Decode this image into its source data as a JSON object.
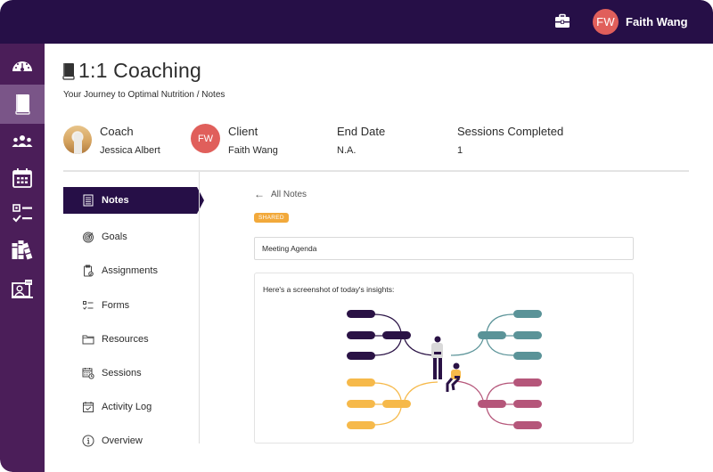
{
  "topbar": {
    "briefcase_icon": "briefcase-icon",
    "user_initials": "FW",
    "user_name": "Faith Wang",
    "avatar_color": "#e05f5b"
  },
  "rail": {
    "items": [
      {
        "icon": "dashboard-gauge-icon",
        "active": false
      },
      {
        "icon": "book-icon",
        "active": true
      },
      {
        "icon": "group-icon",
        "active": false
      },
      {
        "icon": "calendar-icon",
        "active": false
      },
      {
        "icon": "checklist-icon",
        "active": false
      },
      {
        "icon": "library-icon",
        "active": false
      },
      {
        "icon": "presentation-icon",
        "active": false
      }
    ]
  },
  "header": {
    "title": "1:1 Coaching",
    "breadcrumb": "Your Journey to Optimal Nutrition / Notes"
  },
  "info": {
    "coach_label": "Coach",
    "coach_name": "Jessica Albert",
    "client_label": "Client",
    "client_initials": "FW",
    "client_name": "Faith Wang",
    "end_date_label": "End Date",
    "end_date_value": "N.A.",
    "sessions_label": "Sessions Completed",
    "sessions_value": "1"
  },
  "subnav": {
    "items": [
      {
        "label": "Notes",
        "icon": "notes-icon",
        "active": true
      },
      {
        "label": "Goals",
        "icon": "target-icon",
        "active": false
      },
      {
        "label": "Assignments",
        "icon": "clipboard-check-icon",
        "active": false
      },
      {
        "label": "Forms",
        "icon": "form-list-icon",
        "active": false
      },
      {
        "label": "Resources",
        "icon": "folder-icon",
        "active": false
      },
      {
        "label": "Sessions",
        "icon": "calendar-clock-icon",
        "active": false
      },
      {
        "label": "Activity Log",
        "icon": "calendar-check-icon",
        "active": false
      },
      {
        "label": "Overview",
        "icon": "info-icon",
        "active": false
      }
    ]
  },
  "note": {
    "back_label": "All Notes",
    "badge": "SHARED",
    "title_value": "Meeting Agenda",
    "body_text": "Here's a screenshot of today's insights:",
    "image_colors": {
      "navy": "#2a1245",
      "teal": "#5a9398",
      "yellow": "#f6b94a",
      "rose": "#b5567a"
    }
  },
  "colors": {
    "topbar": "#260f47",
    "rail": "#4b1e59",
    "rail_active": "#7a5588",
    "badge": "#f2a93b"
  }
}
